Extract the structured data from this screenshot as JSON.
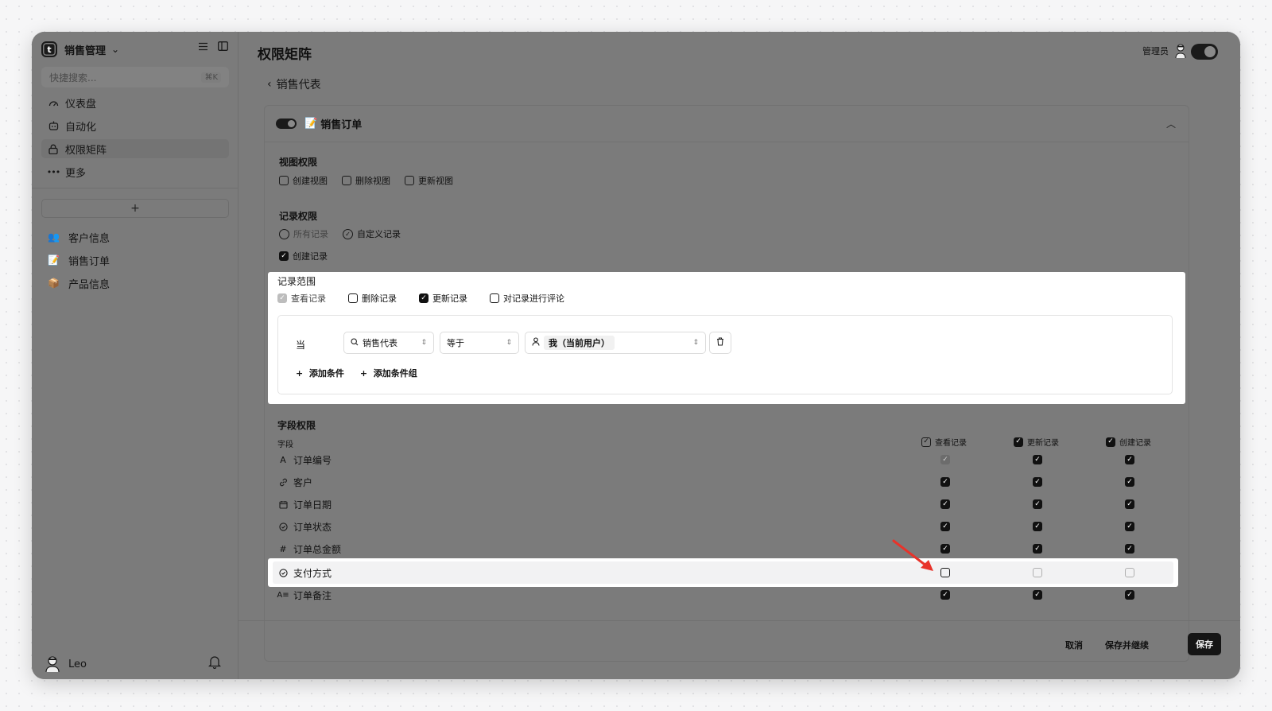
{
  "sidebar": {
    "workspace": "销售管理",
    "logo_letter": "t",
    "search_placeholder": "快捷搜索...",
    "search_shortcut": "⌘K",
    "nav": [
      {
        "label": "仪表盘",
        "icon": "gauge-icon"
      },
      {
        "label": "自动化",
        "icon": "robot-icon"
      },
      {
        "label": "权限矩阵",
        "icon": "lock-icon"
      },
      {
        "label": "更多",
        "icon": "more-icon"
      }
    ],
    "add_label": "+",
    "tables": [
      {
        "label": "客户信息",
        "emoji": "👥"
      },
      {
        "label": "销售订单",
        "emoji": "📝"
      },
      {
        "label": "产品信息",
        "emoji": "📦"
      }
    ],
    "user": "Leo"
  },
  "header": {
    "title": "权限矩阵",
    "admin_label": "管理员",
    "back_label": "销售代表"
  },
  "card": {
    "emoji": "📝",
    "title": "销售订单",
    "view_perm_title": "视图权限",
    "view_perms": [
      "创建视图",
      "删除视图",
      "更新视图"
    ],
    "record_perm_title": "记录权限",
    "record_scope_opts": [
      "所有记录",
      "自定义记录"
    ],
    "create_record": "创建记录",
    "range_title": "记录范围",
    "range_opts": [
      "查看记录",
      "删除记录",
      "更新记录",
      "对记录进行评论"
    ],
    "condition": {
      "when": "当",
      "field": "销售代表",
      "operator": "等于",
      "value": "我（当前用户）",
      "add_condition": "添加条件",
      "add_group": "添加条件组"
    },
    "field_perm_title": "字段权限",
    "field_col_label": "字段",
    "columns": [
      "查看记录",
      "更新记录",
      "创建记录"
    ],
    "fields": [
      {
        "name": "订单编号",
        "icon": "text-icon"
      },
      {
        "name": "客户",
        "icon": "link-icon"
      },
      {
        "name": "订单日期",
        "icon": "calendar-icon"
      },
      {
        "name": "订单状态",
        "icon": "status-icon"
      },
      {
        "name": "订单总金额",
        "icon": "hash-icon"
      },
      {
        "name": "支付方式",
        "icon": "status-icon"
      },
      {
        "name": "订单备注",
        "icon": "long-text-icon"
      }
    ]
  },
  "footer": {
    "cancel": "取消",
    "save_continue": "保存并继续",
    "save": "保存"
  }
}
